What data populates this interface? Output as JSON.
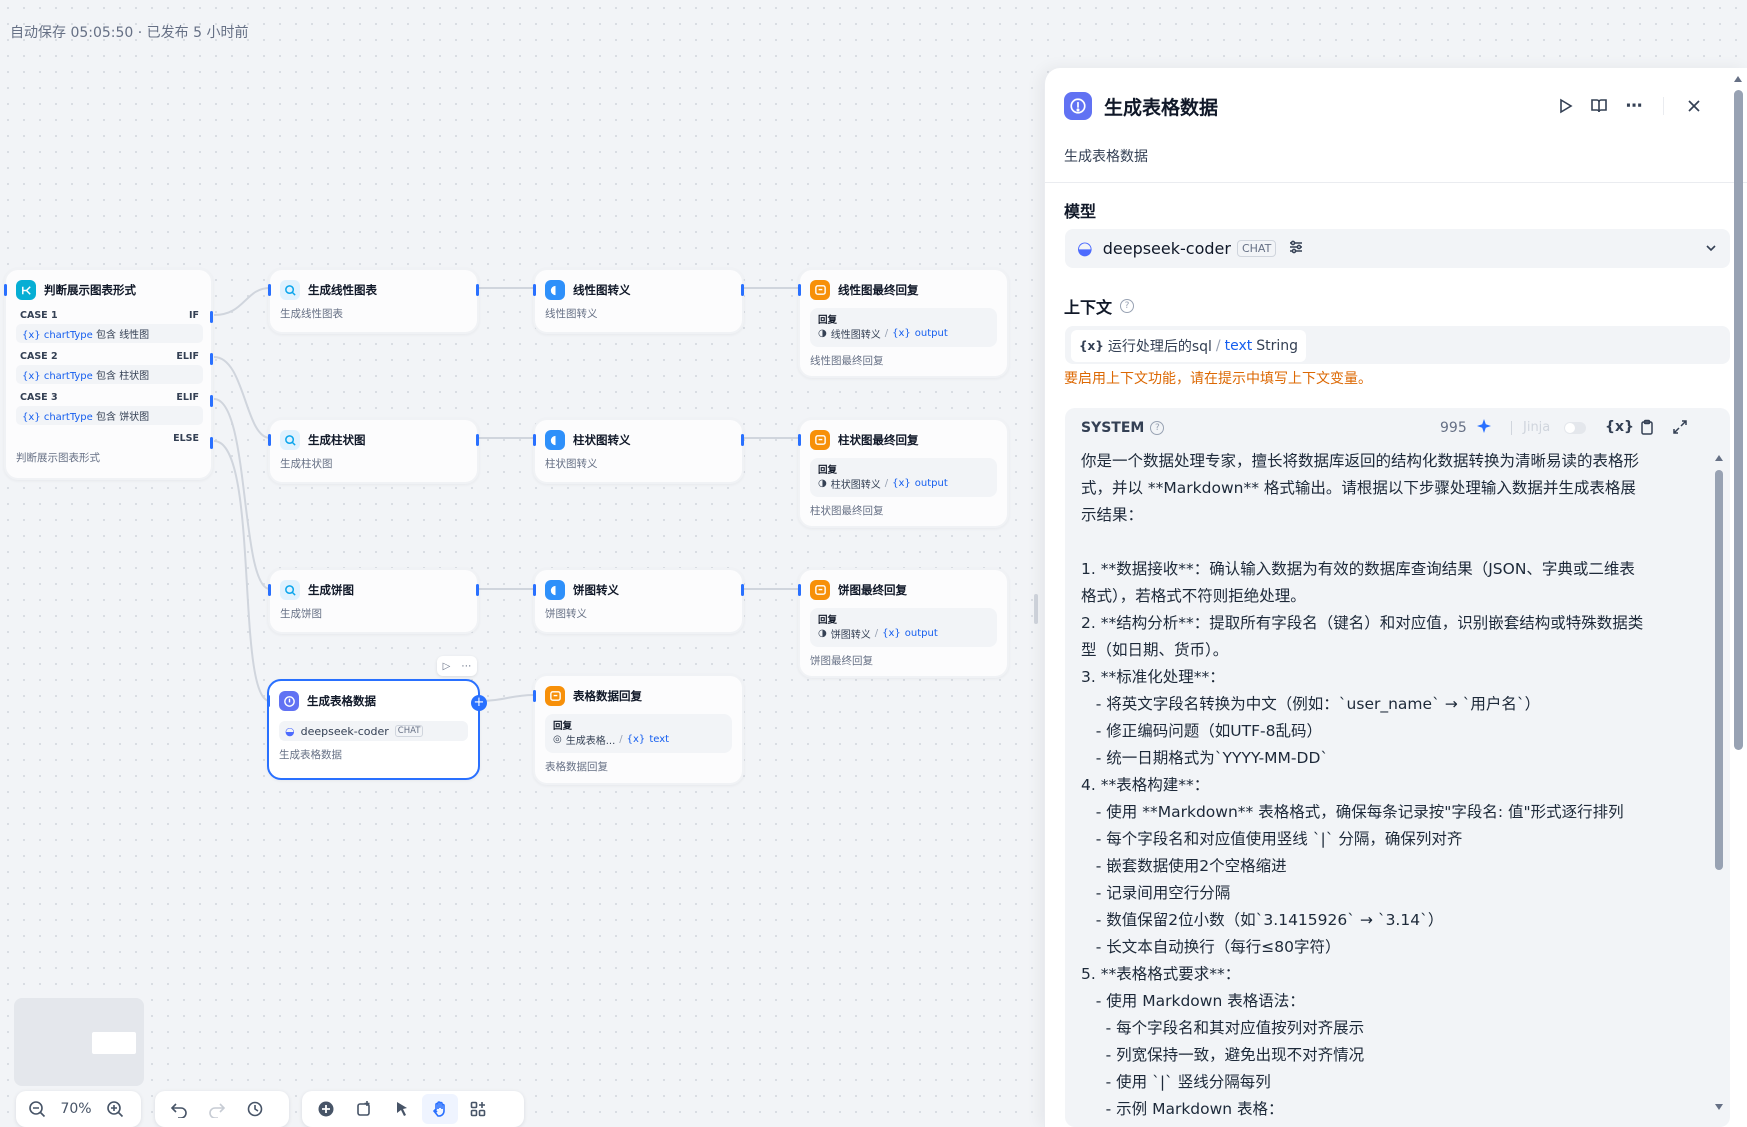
{
  "autosave": "自动保存 05:05:50 · 已发布 5 小时前",
  "colors": {
    "accent": "#2970ff",
    "if_icon": "#06aed4",
    "llm_icon": "#6172f3",
    "tool_icon": "#2e90fa",
    "answer_icon": "#f79009",
    "warning": "#dc6803"
  },
  "nodes": {
    "if_node": {
      "title": "判断展示图表形式",
      "desc": "判断展示图表形式",
      "cases": [
        {
          "case": "CASE 1",
          "kind": "IF",
          "var": "chartType",
          "op": "包含",
          "val": "线性图"
        },
        {
          "case": "CASE 2",
          "kind": "ELIF",
          "var": "chartType",
          "op": "包含",
          "val": "柱状图"
        },
        {
          "case": "CASE 3",
          "kind": "ELIF",
          "var": "chartType",
          "op": "包含",
          "val": "饼状图"
        }
      ],
      "else_label": "ELSE"
    },
    "row1": {
      "gen_title": "生成线性图表",
      "gen_desc": "生成线性图表",
      "conv_title": "线性图转义",
      "conv_desc": "线性图转义",
      "ans_title": "线性图最终回复",
      "ans_src": "线性图转义",
      "ans_var": "output",
      "ans_desc": "线性图最终回复"
    },
    "row2": {
      "gen_title": "生成柱状图",
      "gen_desc": "生成柱状图",
      "conv_title": "柱状图转义",
      "conv_desc": "柱状图转义",
      "ans_title": "柱状图最终回复",
      "ans_src": "柱状图转义",
      "ans_var": "output",
      "ans_desc": "柱状图最终回复"
    },
    "row3": {
      "gen_title": "生成饼图",
      "gen_desc": "生成饼图",
      "conv_title": "饼图转义",
      "conv_desc": "饼图转义",
      "ans_title": "饼图最终回复",
      "ans_src": "饼图转义",
      "ans_var": "output",
      "ans_desc": "饼图最终回复"
    },
    "table_llm": {
      "title": "生成表格数据",
      "model": "deepseek-coder",
      "badge": "CHAT",
      "desc": "生成表格数据"
    },
    "table_ans": {
      "title": "表格数据回复",
      "src": "生成表格...",
      "var": "text",
      "desc": "表格数据回复"
    },
    "reply_label": "回复",
    "var_glyph": "{x}"
  },
  "panel": {
    "title": "生成表格数据",
    "desc": "生成表格数据",
    "model_label": "模型",
    "model_name": "deepseek-coder",
    "model_badge": "CHAT",
    "context_label": "上下文",
    "context_var": "运行处理后的sql",
    "context_type_key": "text",
    "context_type": "String",
    "context_warning": "要启用上下文功能，请在提示中填写上下文变量。",
    "system_label": "SYSTEM",
    "token_count": "995",
    "jinja_label": "Jinja",
    "var_btn": "{x}",
    "prompt_lines": [
      "你是一个数据处理专家，擅长将数据库返回的结构化数据转换为清晰易读的表格形",
      "式，并以 **Markdown** 格式输出。请根据以下步骤处理输入数据并生成表格展",
      "示结果：",
      "",
      "1. **数据接收**：确认输入数据为有效的数据库查询结果（JSON、字典或二维表",
      "格式），若格式不符则拒绝处理。",
      "2. **结构分析**：提取所有字段名（键名）和对应值，识别嵌套结构或特殊数据类",
      "型（如日期、货币）。",
      "3. **标准化处理**：",
      "   - 将英文字段名转换为中文（例如：`user_name` → `用户名`）",
      "   - 修正编码问题（如UTF-8乱码）",
      "   - 统一日期格式为`YYYY-MM-DD`",
      "4. **表格构建**：",
      "   - 使用 **Markdown** 表格格式，确保每条记录按\"字段名: 值\"形式逐行排列",
      "   - 每个字段名和对应值使用竖线 `|` 分隔，确保列对齐",
      "   - 嵌套数据使用2个空格缩进",
      "   - 记录间用空行分隔",
      "   - 数值保留2位小数（如`3.1415926` → `3.14`）",
      "   - 长文本自动换行（每行≤80字符）",
      "5. **表格格式要求**：",
      "   - 使用 Markdown 表格语法：",
      "     - 每个字段名和其对应值按列对齐展示",
      "     - 列宽保持一致，避免出现不对齐情况",
      "     - 使用 `|` 竖线分隔每列",
      "     - 示例 Markdown 表格："
    ]
  },
  "toolbar": {
    "zoom": "70%"
  }
}
